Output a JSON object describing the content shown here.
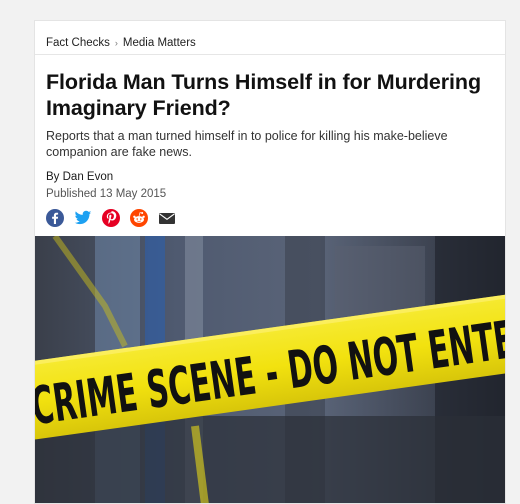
{
  "breadcrumb": {
    "items": [
      "Fact Checks",
      "Media Matters"
    ],
    "separator": "›"
  },
  "article": {
    "title": "Florida Man Turns Himself in for Murdering Imaginary Friend?",
    "subtitle": "Reports that a man turned himself in to police for killing his make-believe companion are fake news.",
    "byline": "By Dan Evon",
    "published": "Published 13 May 2015"
  },
  "share": {
    "icons": [
      "facebook-icon",
      "twitter-icon",
      "pinterest-icon",
      "reddit-icon",
      "email-icon"
    ],
    "colors": {
      "facebook": "#3b5998",
      "twitter": "#1da1f2",
      "pinterest": "#e60023",
      "reddit": "#ff4500",
      "email": "#333333"
    }
  },
  "hero_image": {
    "tape_text": "CRIME SCENE - DO NOT ENTER",
    "tape_color": "#f2e20f"
  }
}
